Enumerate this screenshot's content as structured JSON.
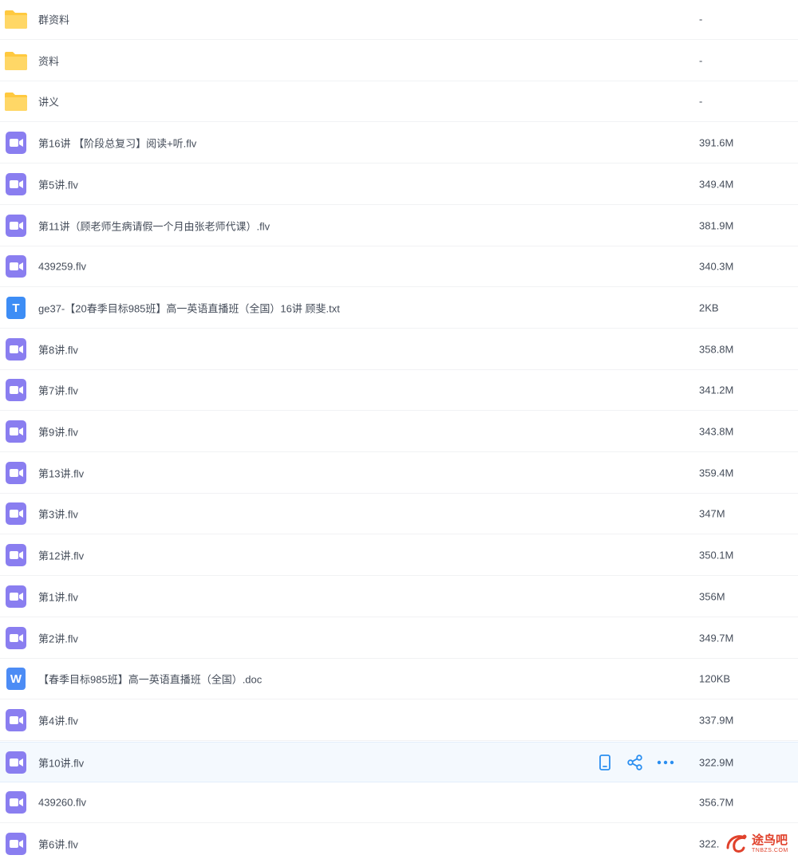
{
  "files": [
    {
      "name": "群资料",
      "size": "-",
      "type": "folder"
    },
    {
      "name": "资料",
      "size": "-",
      "type": "folder"
    },
    {
      "name": "讲义",
      "size": "-",
      "type": "folder"
    },
    {
      "name": "第16讲 【阶段总复习】阅读+听.flv",
      "size": "391.6M",
      "type": "video"
    },
    {
      "name": "第5讲.flv",
      "size": "349.4M",
      "type": "video"
    },
    {
      "name": "第11讲（顾老师生病请假一个月由张老师代课）.flv",
      "size": "381.9M",
      "type": "video"
    },
    {
      "name": "439259.flv",
      "size": "340.3M",
      "type": "video"
    },
    {
      "name": "ge37-【20春季目标985班】高一英语直播班（全国）16讲 顾斐.txt",
      "size": "2KB",
      "type": "text"
    },
    {
      "name": "第8讲.flv",
      "size": "358.8M",
      "type": "video"
    },
    {
      "name": "第7讲.flv",
      "size": "341.2M",
      "type": "video"
    },
    {
      "name": "第9讲.flv",
      "size": "343.8M",
      "type": "video"
    },
    {
      "name": "第13讲.flv",
      "size": "359.4M",
      "type": "video"
    },
    {
      "name": "第3讲.flv",
      "size": "347M",
      "type": "video"
    },
    {
      "name": "第12讲.flv",
      "size": "350.1M",
      "type": "video"
    },
    {
      "name": "第1讲.flv",
      "size": "356M",
      "type": "video"
    },
    {
      "name": "第2讲.flv",
      "size": "349.7M",
      "type": "video"
    },
    {
      "name": "【春季目标985班】高一英语直播班（全国）.doc",
      "size": "120KB",
      "type": "word"
    },
    {
      "name": "第4讲.flv",
      "size": "337.9M",
      "type": "video"
    },
    {
      "name": "第10讲.flv",
      "size": "322.9M",
      "type": "video",
      "hovered": true
    },
    {
      "name": "439260.flv",
      "size": "356.7M",
      "type": "video"
    },
    {
      "name": "第6讲.flv",
      "size": "322.",
      "type": "video"
    }
  ],
  "icons": {
    "folder": "folder-icon",
    "video": "video-file-icon",
    "text": "text-file-icon",
    "word": "word-file-icon",
    "text_letter": "T",
    "word_letter": "W"
  },
  "row_actions": [
    "phone-transfer-icon",
    "share-icon",
    "more-icon"
  ],
  "colors": {
    "folder": "#ffc93f",
    "video": "#8a7ef0",
    "text": "#3d8df5",
    "word": "#4c8cf5",
    "action": "#2a8ef0",
    "watermark": "#e0412b"
  },
  "watermark": {
    "cn": "途鸟吧",
    "en": "TNBZS.COM"
  }
}
